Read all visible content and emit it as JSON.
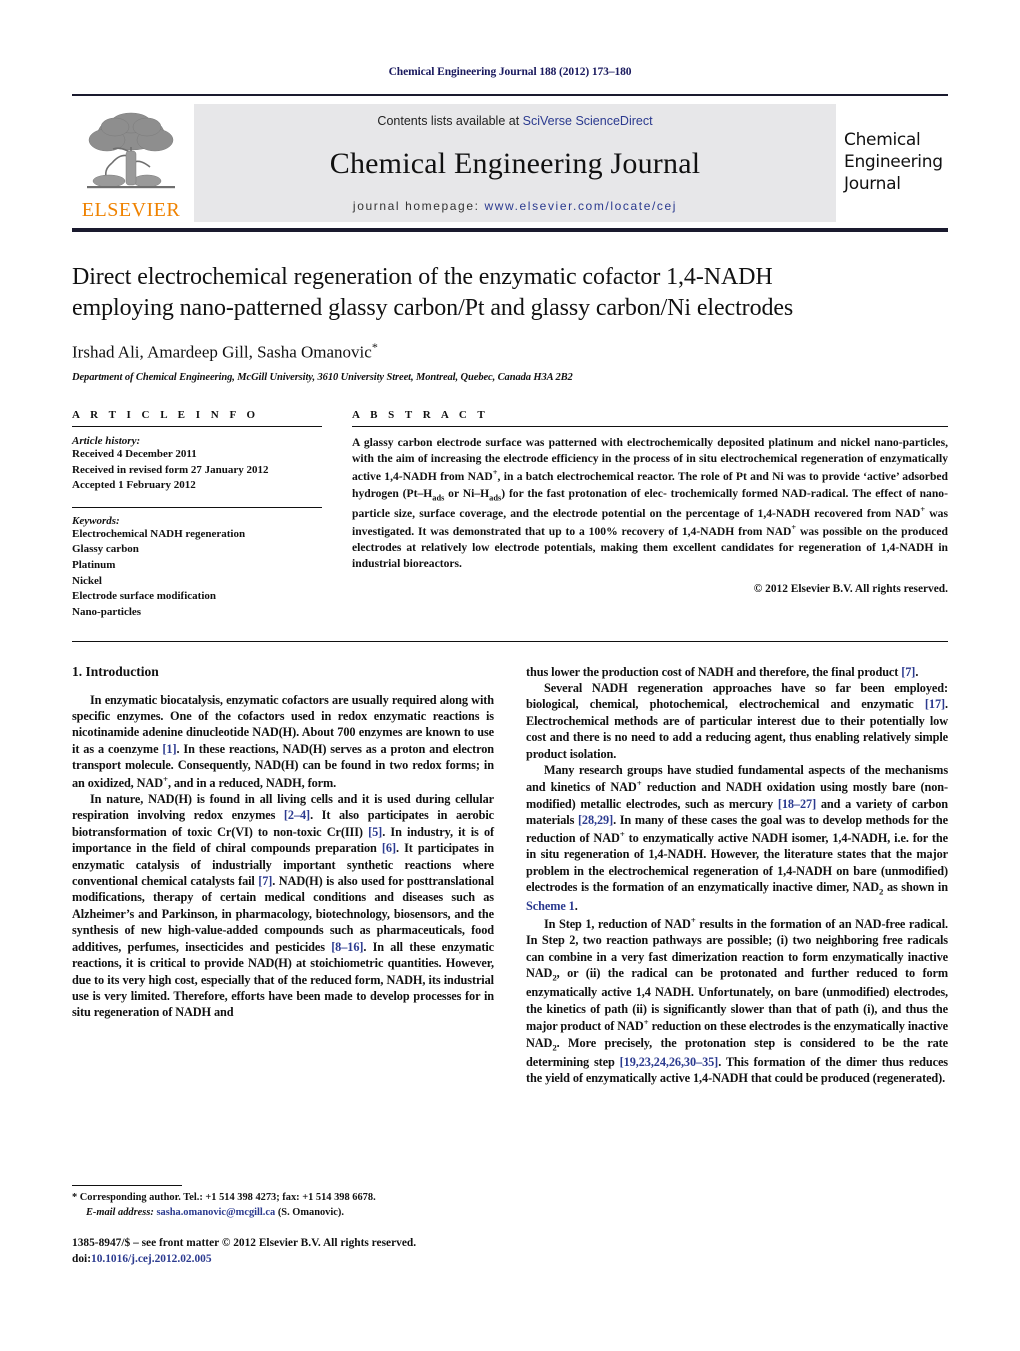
{
  "running_head": "Chemical Engineering Journal 188 (2012) 173–180",
  "masthead": {
    "publisher_name": "ELSEVIER",
    "contents_prefix": "Contents lists available at ",
    "contents_link": "SciVerse ScienceDirect",
    "journal_title": "Chemical Engineering Journal",
    "homepage_prefix": "journal homepage: ",
    "homepage_url": "www.elsevier.com/locate/cej",
    "cover_lines": [
      "Chemical",
      "Engineering",
      "Journal"
    ],
    "link_color": "#2b3a8f",
    "brand_color": "#ef8200",
    "band_color": "#e7e7e9"
  },
  "article": {
    "title_line1": "Direct electrochemical regeneration of the enzymatic cofactor 1,4-NADH",
    "title_line2": "employing nano-patterned glassy carbon/Pt and glassy carbon/Ni electrodes",
    "authors": "Irshad Ali, Amardeep Gill, Sasha Omanovic",
    "author_star": "*",
    "affiliation": "Department of Chemical Engineering, McGill University, 3610 University Street, Montreal, Quebec, Canada H3A 2B2"
  },
  "article_info": {
    "heading": "A R T I C L E  I N F O",
    "history_label": "Article history:",
    "history": [
      "Received 4 December 2011",
      "Received in revised form 27 January 2012",
      "Accepted 1 February 2012"
    ],
    "keywords_label": "Keywords:",
    "keywords": [
      "Electrochemical NADH regeneration",
      "Glassy carbon",
      "Platinum",
      "Nickel",
      "Electrode surface modification",
      "Nano-particles"
    ]
  },
  "abstract": {
    "heading": "A B S T R A C T",
    "copyright": "© 2012 Elsevier B.V. All rights reserved."
  },
  "body": {
    "section_number_title": "1. Introduction",
    "left_paragraphs": [
      "In enzymatic biocatalysis, enzymatic cofactors are usually required along with specific enzymes. One of the cofactors used in redox enzymatic reactions is nicotinamide adenine dinucleotide NAD(H). About 700 enzymes are known to use it as a coenzyme [1]. In these reactions, NAD(H) serves as a proton and electron transport molecule. Consequently, NAD(H) can be found in two redox forms; in an oxidized, NAD+, and in a reduced, NADH, form."
    ],
    "right_paragraphs": []
  },
  "footnote": {
    "corresponding": "* Corresponding author. Tel.: +1 514 398 4273; fax: +1 514 398 6678.",
    "email_label": "E-mail address:",
    "email": "sasha.omanovic@mcgill.ca",
    "email_owner": "(S. Omanovic).",
    "issn_line": "1385-8947/$ – see front matter © 2012 Elsevier B.V. All rights reserved.",
    "doi_prefix": "doi:",
    "doi": "10.1016/j.cej.2012.02.005"
  }
}
